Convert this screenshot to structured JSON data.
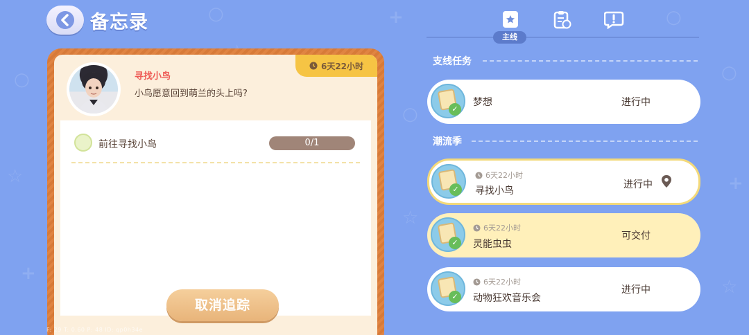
{
  "header": {
    "title": "备忘录",
    "back_icon": "back-arrow-icon"
  },
  "tabs": {
    "active_label": "主线",
    "icons": [
      "main-quest-book-icon",
      "clipboard-clock-icon",
      "exclamation-speech-icon"
    ]
  },
  "detail": {
    "timer": "6天22小时",
    "quest_name": "寻找小鸟",
    "description": "小鸟愿意回到萌兰的头上吗?",
    "objective": {
      "label": "前往寻找小鸟",
      "progress": "0/1"
    },
    "cancel_button": "取消追踪"
  },
  "sections": [
    {
      "title": "支线任务",
      "items": [
        {
          "name": "梦想",
          "status": "进行中",
          "timer": "",
          "state": "normal"
        }
      ]
    },
    {
      "title": "潮流季",
      "items": [
        {
          "name": "寻找小鸟",
          "status": "进行中",
          "timer": "6天22小时",
          "state": "selected"
        },
        {
          "name": "灵能虫虫",
          "status": "可交付",
          "timer": "6天22小时",
          "state": "ready"
        },
        {
          "name": "动物狂欢音乐会",
          "status": "进行中",
          "timer": "6天22小时",
          "state": "normal"
        }
      ]
    }
  ],
  "debug": "F: 29   T: 0.60   P: 48   ID: qp0h34e",
  "colors": {
    "background": "#7fa2f0",
    "card_border": "#e08442",
    "timer_tab": "#f6c444",
    "ready_item": "#fff0ba",
    "selected_border": "#f3d97a"
  }
}
